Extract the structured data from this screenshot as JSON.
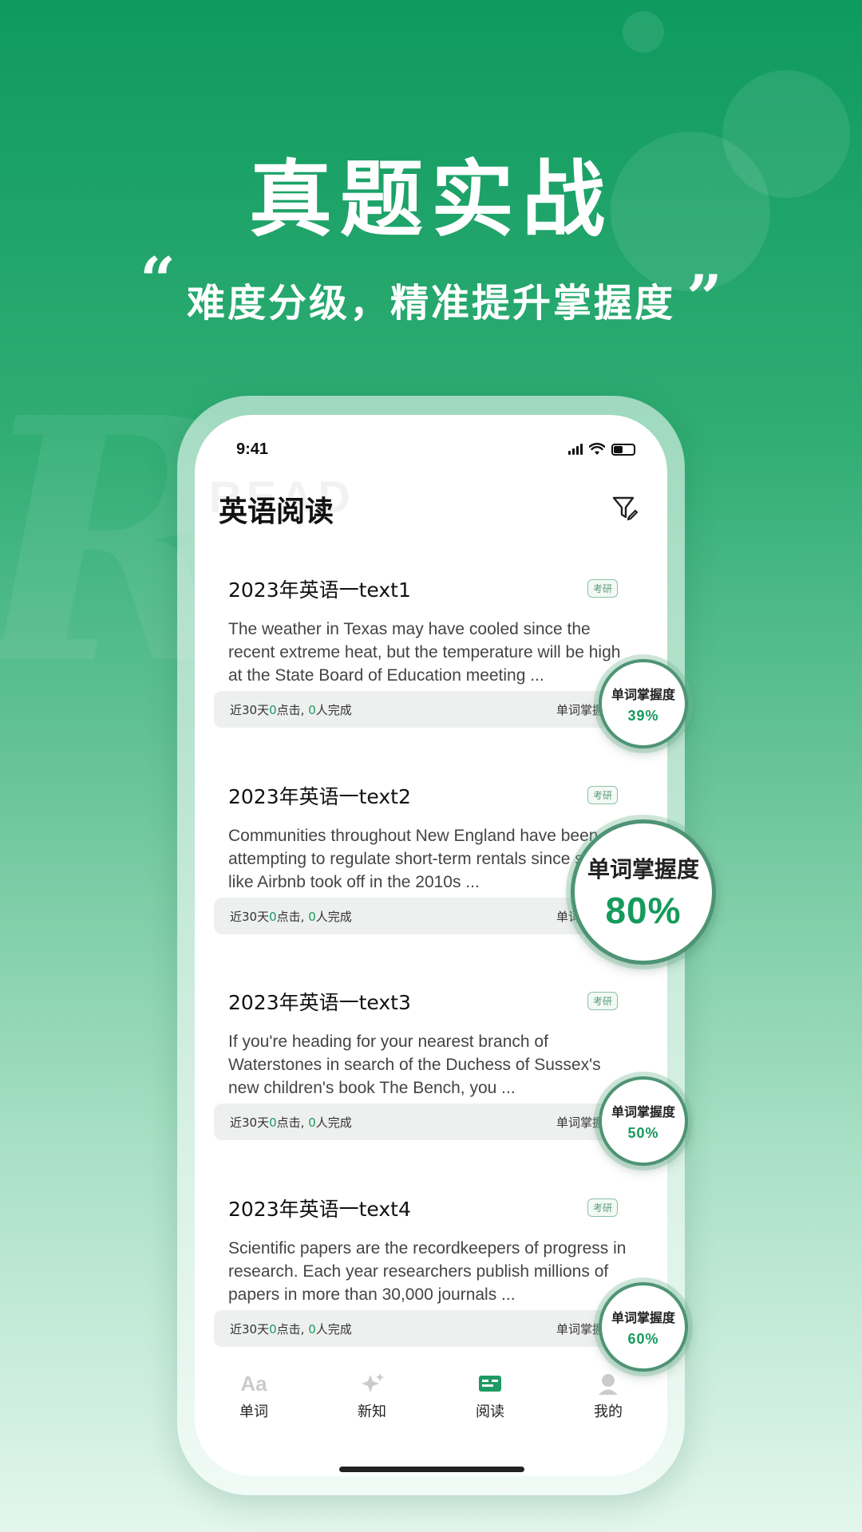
{
  "banner": {
    "headline": "真题实战",
    "quote_open": "“",
    "subtitle": "难度分级，精准提升掌握度",
    "quote_close": "”"
  },
  "status_bar": {
    "time": "9:41"
  },
  "app": {
    "title": "英语阅读",
    "watermark": "READ"
  },
  "articles": [
    {
      "title": "2023年英语一text1",
      "badge": "考研",
      "excerpt": "The weather in Texas may have cooled since the recent extreme heat, but the temperature will be high at the State Board of Education meeting ...",
      "stats_prefix": "近30天",
      "clicks": "0",
      "stats_mid": "点击, ",
      "completions": "0",
      "stats_suffix": "人完成",
      "mastery_label": "单词掌握度",
      "mastery_percent": "39%"
    },
    {
      "title": "2023年英语一text2",
      "badge": "考研",
      "excerpt": "Communities throughout New England have been attempting to regulate short-term rentals since sites like Airbnb took off in the 2010s ...",
      "stats_prefix": "近30天",
      "clicks": "0",
      "stats_mid": "点击, ",
      "completions": "0",
      "stats_suffix": "人完成",
      "mastery_label": "单词掌握度",
      "mastery_percent": "80%"
    },
    {
      "title": "2023年英语一text3",
      "badge": "考研",
      "excerpt": "If you're heading for your nearest branch of Waterstones in search of the Duchess of Sussex's new children's book The Bench, you ...",
      "stats_prefix": "近30天",
      "clicks": "0",
      "stats_mid": "点击, ",
      "completions": "0",
      "stats_suffix": "人完成",
      "mastery_label": "单词掌握度",
      "mastery_percent": "50%"
    },
    {
      "title": "2023年英语一text4",
      "badge": "考研",
      "excerpt": "Scientific papers are the recordkeepers of progress in research. Each year researchers publish millions of papers in more than 30,000 journals ...",
      "stats_prefix": "近30天",
      "clicks": "0",
      "stats_mid": "点击, ",
      "completions": "0",
      "stats_suffix": "人完成",
      "mastery_label": "单词掌握度",
      "mastery_percent": "60%"
    }
  ],
  "tabs": [
    {
      "label": "单词",
      "icon": "aa-icon",
      "glyph": "Aa",
      "active": false
    },
    {
      "label": "新知",
      "icon": "sparkle-icon",
      "active": false
    },
    {
      "label": "阅读",
      "icon": "reading-icon",
      "active": true
    },
    {
      "label": "我的",
      "icon": "profile-icon",
      "active": false
    }
  ],
  "colors": {
    "accent": "#169a5c",
    "bubble_border": "#4d9474",
    "inactive_icon": "#c9cccb"
  }
}
